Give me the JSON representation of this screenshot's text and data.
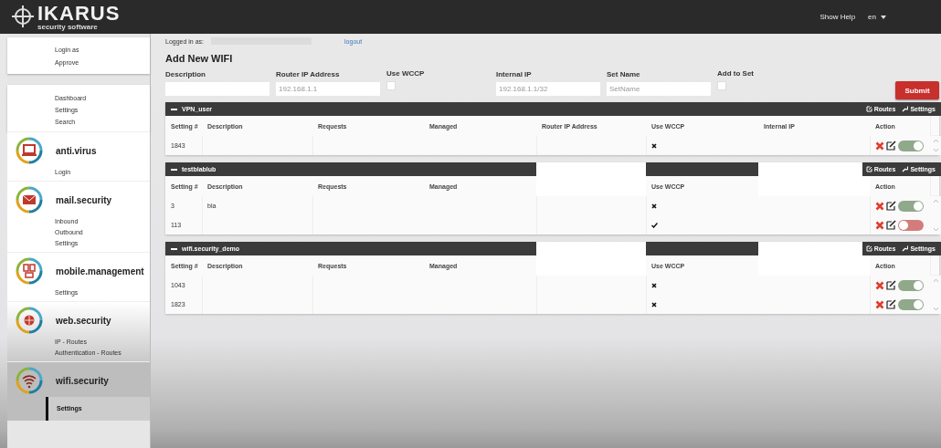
{
  "header": {
    "logo_title": "IKARUS",
    "logo_subtitle": "security software",
    "help": "Show Help",
    "language": "en"
  },
  "sidebar": {
    "account": [
      {
        "label": "Login as",
        "selected": false
      },
      {
        "label": "Approve",
        "selected": false
      }
    ],
    "general": [
      {
        "label": "Dashboard",
        "selected": false
      },
      {
        "label": "Settings",
        "selected": false
      },
      {
        "label": "Search",
        "selected": false
      }
    ],
    "products": [
      {
        "name": "anti.virus",
        "kind": "laptop",
        "items": [
          {
            "label": "Login",
            "selected": false
          }
        ]
      },
      {
        "name": "mail.security",
        "kind": "envelope",
        "items": [
          {
            "label": "Inbound",
            "selected": false
          },
          {
            "label": "Outbound",
            "selected": false
          },
          {
            "label": "Settings",
            "selected": false
          }
        ]
      },
      {
        "name": "mobile.management",
        "kind": "devices",
        "items": [
          {
            "label": "Settings",
            "selected": false
          }
        ]
      },
      {
        "name": "web.security",
        "kind": "globe",
        "items": [
          {
            "label": "IP - Routes",
            "selected": false
          },
          {
            "label": "Authentication - Routes",
            "selected": false
          }
        ]
      },
      {
        "name": "wifi.security",
        "kind": "wifi",
        "items": [
          {
            "label": "Settings",
            "selected": true
          }
        ]
      }
    ]
  },
  "session": {
    "label": "Logged in as:",
    "logout": "logout"
  },
  "form": {
    "title": "Add New WIFI",
    "fields": [
      {
        "kind": "text",
        "label": "Description"
      },
      {
        "kind": "text",
        "label": "Router IP Address",
        "placeholder": "192.168.1.1"
      },
      {
        "kind": "checkbox",
        "label": "Use WCCP",
        "checked": false
      },
      {
        "kind": "text",
        "label": "Internal IP",
        "placeholder": "192.168.1.1/32"
      },
      {
        "kind": "text",
        "label": "Set Name",
        "placeholder": "SetName"
      },
      {
        "kind": "checkbox",
        "label": "Add to Set",
        "checked": false
      }
    ],
    "submit": "Submit"
  },
  "tables": [
    {
      "name": "VPN_user",
      "routes": "Routes",
      "settings": "Settings",
      "columns": [
        {
          "label": "Setting #"
        },
        {
          "label": "Description"
        },
        {
          "label": "Requests"
        },
        {
          "label": "Managed"
        },
        {
          "label": "Router IP Address"
        },
        {
          "label": "Use WCCP"
        },
        {
          "label": "Internal IP"
        },
        {
          "label": "Action"
        }
      ],
      "rows": [
        {
          "setting": "1843",
          "use_wccp": false,
          "enabled": true
        }
      ]
    },
    {
      "name": "testblablub",
      "routes": "Routes",
      "settings": "Settings",
      "columns": [
        {
          "label": "Setting #"
        },
        {
          "label": "Description"
        },
        {
          "label": "Requests"
        },
        {
          "label": "Managed"
        },
        {
          "redacted": true
        },
        {
          "label": "Use WCCP"
        },
        {
          "redacted": true
        },
        {
          "label": "Action"
        }
      ],
      "rows": [
        {
          "setting": "3",
          "description": "bla",
          "use_wccp": false,
          "enabled": true
        },
        {
          "setting": "113",
          "use_wccp": true,
          "enabled": false
        }
      ]
    },
    {
      "name": "wifi.security_demo",
      "routes": "Routes",
      "settings": "Settings",
      "columns": [
        {
          "label": "Setting #"
        },
        {
          "label": "Description"
        },
        {
          "label": "Requests"
        },
        {
          "label": "Managed"
        },
        {
          "redacted": true
        },
        {
          "label": "Use WCCP"
        },
        {
          "redacted": true
        },
        {
          "label": "Action"
        }
      ],
      "rows": [
        {
          "setting": "1043",
          "use_wccp": false,
          "enabled": true
        },
        {
          "setting": "1823",
          "use_wccp": false,
          "enabled": true
        }
      ]
    }
  ]
}
